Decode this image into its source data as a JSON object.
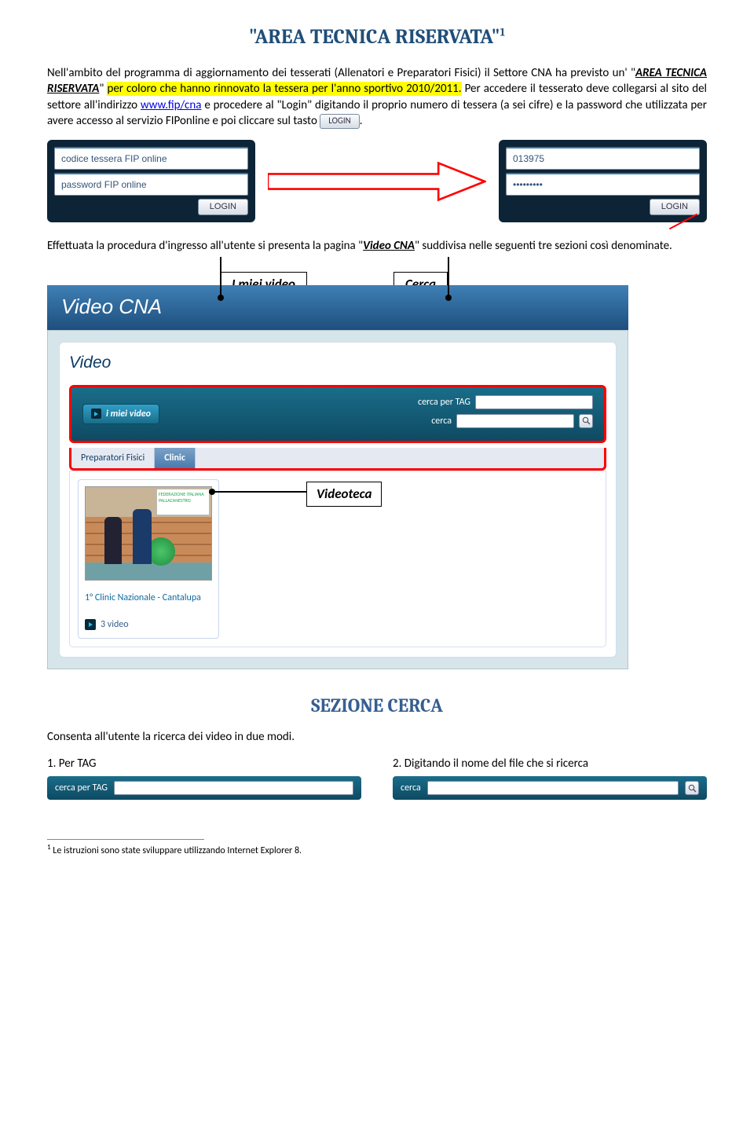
{
  "title": "\"AREA TECNICA RISERVATA\"",
  "title_sup": "1",
  "intro1_a": "Nell'ambito del programma di aggiornamento dei tesserati (Allenatori e Preparatori Fisici) il Settore CNA ha previsto un' \"",
  "intro1_b": "AREA TECNICA RISERVATA",
  "intro1_c": "\" ",
  "intro1_d": "per coloro che hanno rinnovato la tessera per l'anno sportivo 2010/2011.",
  "intro1_e": " Per accedere il tesserato deve collegarsi al sito del settore all'indirizzo ",
  "intro1_f": "www.fip/cna",
  "intro1_g": " e procedere al \"Login\" digitando il proprio numero di tessera (a sei cifre) e la password che utilizzata per avere accesso al servizio FIPonline e poi cliccare sul tasto ",
  "login_inline": "LOGIN",
  "period": ".",
  "login_left": {
    "field1": "codice tessera FIP online",
    "field2": "password FIP online",
    "btn": "LOGIN"
  },
  "login_right": {
    "field1": "013975",
    "field2": "•••••••••",
    "btn": "LOGIN"
  },
  "para2_a": "Effettuata la procedura d'ingresso all'utente si presenta la pagina \"",
  "para2_b": "Video CNA",
  "para2_c": "\" suddivisa nelle seguenti tre sezioni così denominate.",
  "callouts": {
    "my_videos": "I miei video",
    "cerca": "Cerca",
    "videoteca": "Videoteca"
  },
  "videocna": {
    "header": "Video CNA",
    "video_title": "Video",
    "my_videos_btn": "i miei video",
    "search_tag_label": "cerca per TAG",
    "search_label": "cerca",
    "tabs": [
      "Preparatori Fisici",
      "Clinic"
    ],
    "thumb": {
      "banner": "FEDERAZIONE ITALIANA PALLACANESTRO",
      "title": "1° Clinic Nazionale - Cantalupa",
      "footer": "3 video"
    }
  },
  "sezione_heading": "SEZIONE CERCA",
  "sezione_intro": "Consenta all'utente la ricerca dei video in due modi.",
  "opt1": "1.   Per TAG",
  "opt2": "2.   Digitando il nome del file che si ricerca",
  "bar1_label": "cerca per TAG",
  "bar2_label": "cerca",
  "footnote_sup": "1",
  "footnote": " Le istruzioni sono state sviluppare utilizzando Internet Explorer 8."
}
